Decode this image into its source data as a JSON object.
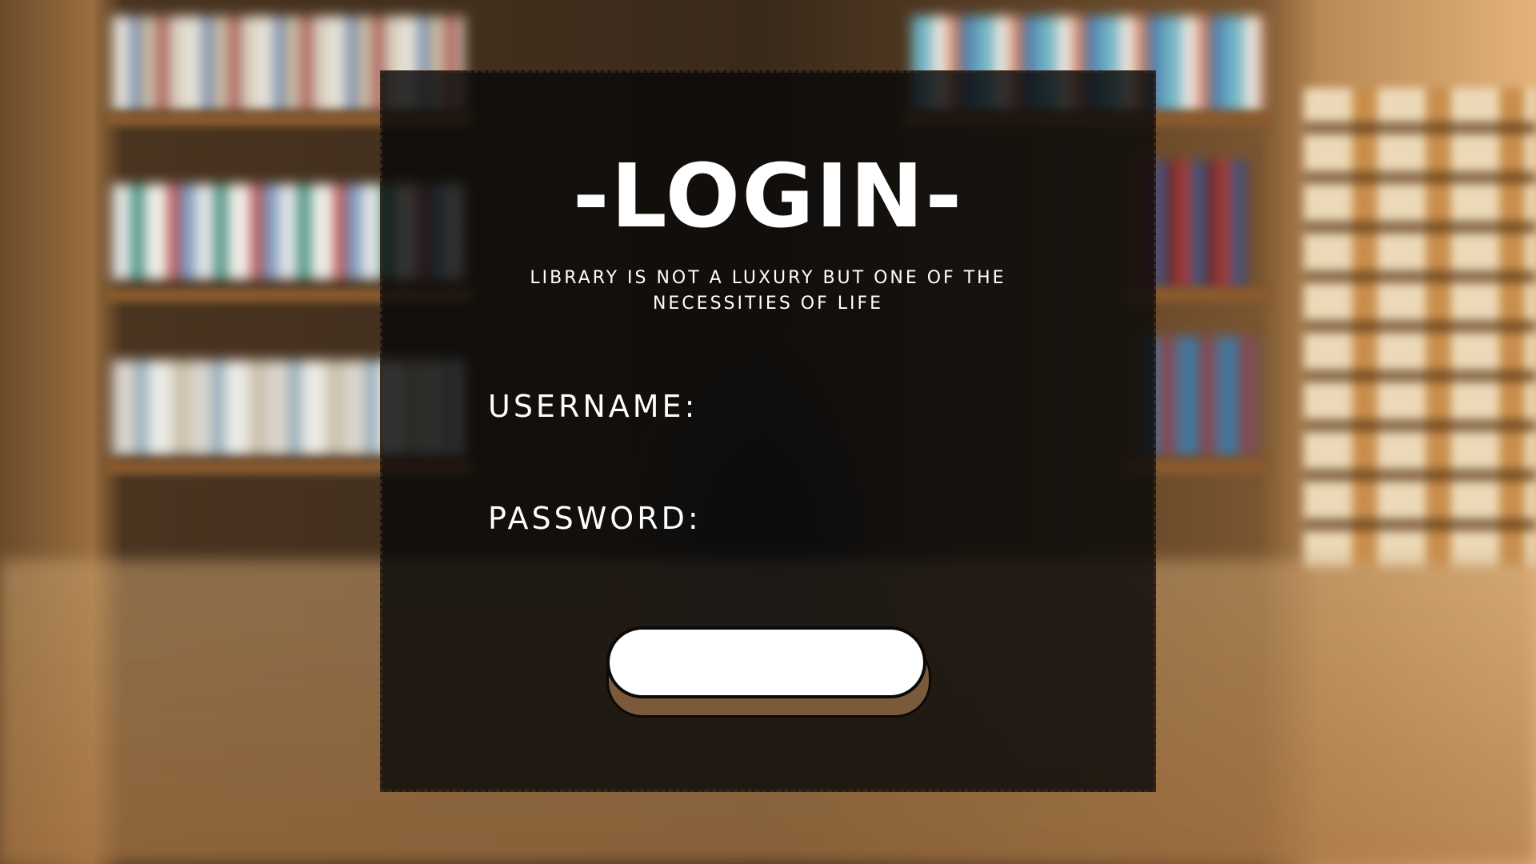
{
  "page": {
    "title": "-LOGIN-",
    "subtitle_line1": "LIBRARY IS NOT A LUXURY BUT ONE OF THE",
    "subtitle_line2": "NECESSITIES OF LIFE"
  },
  "form": {
    "username_label": "USERNAME:",
    "password_label": "PASSWORD:",
    "username_value": "",
    "password_value": "",
    "submit_label": ""
  },
  "colors": {
    "panel": "#080808",
    "text": "#ffffff",
    "button": "#ffffff",
    "button_shadow": "#7a5a3a"
  }
}
